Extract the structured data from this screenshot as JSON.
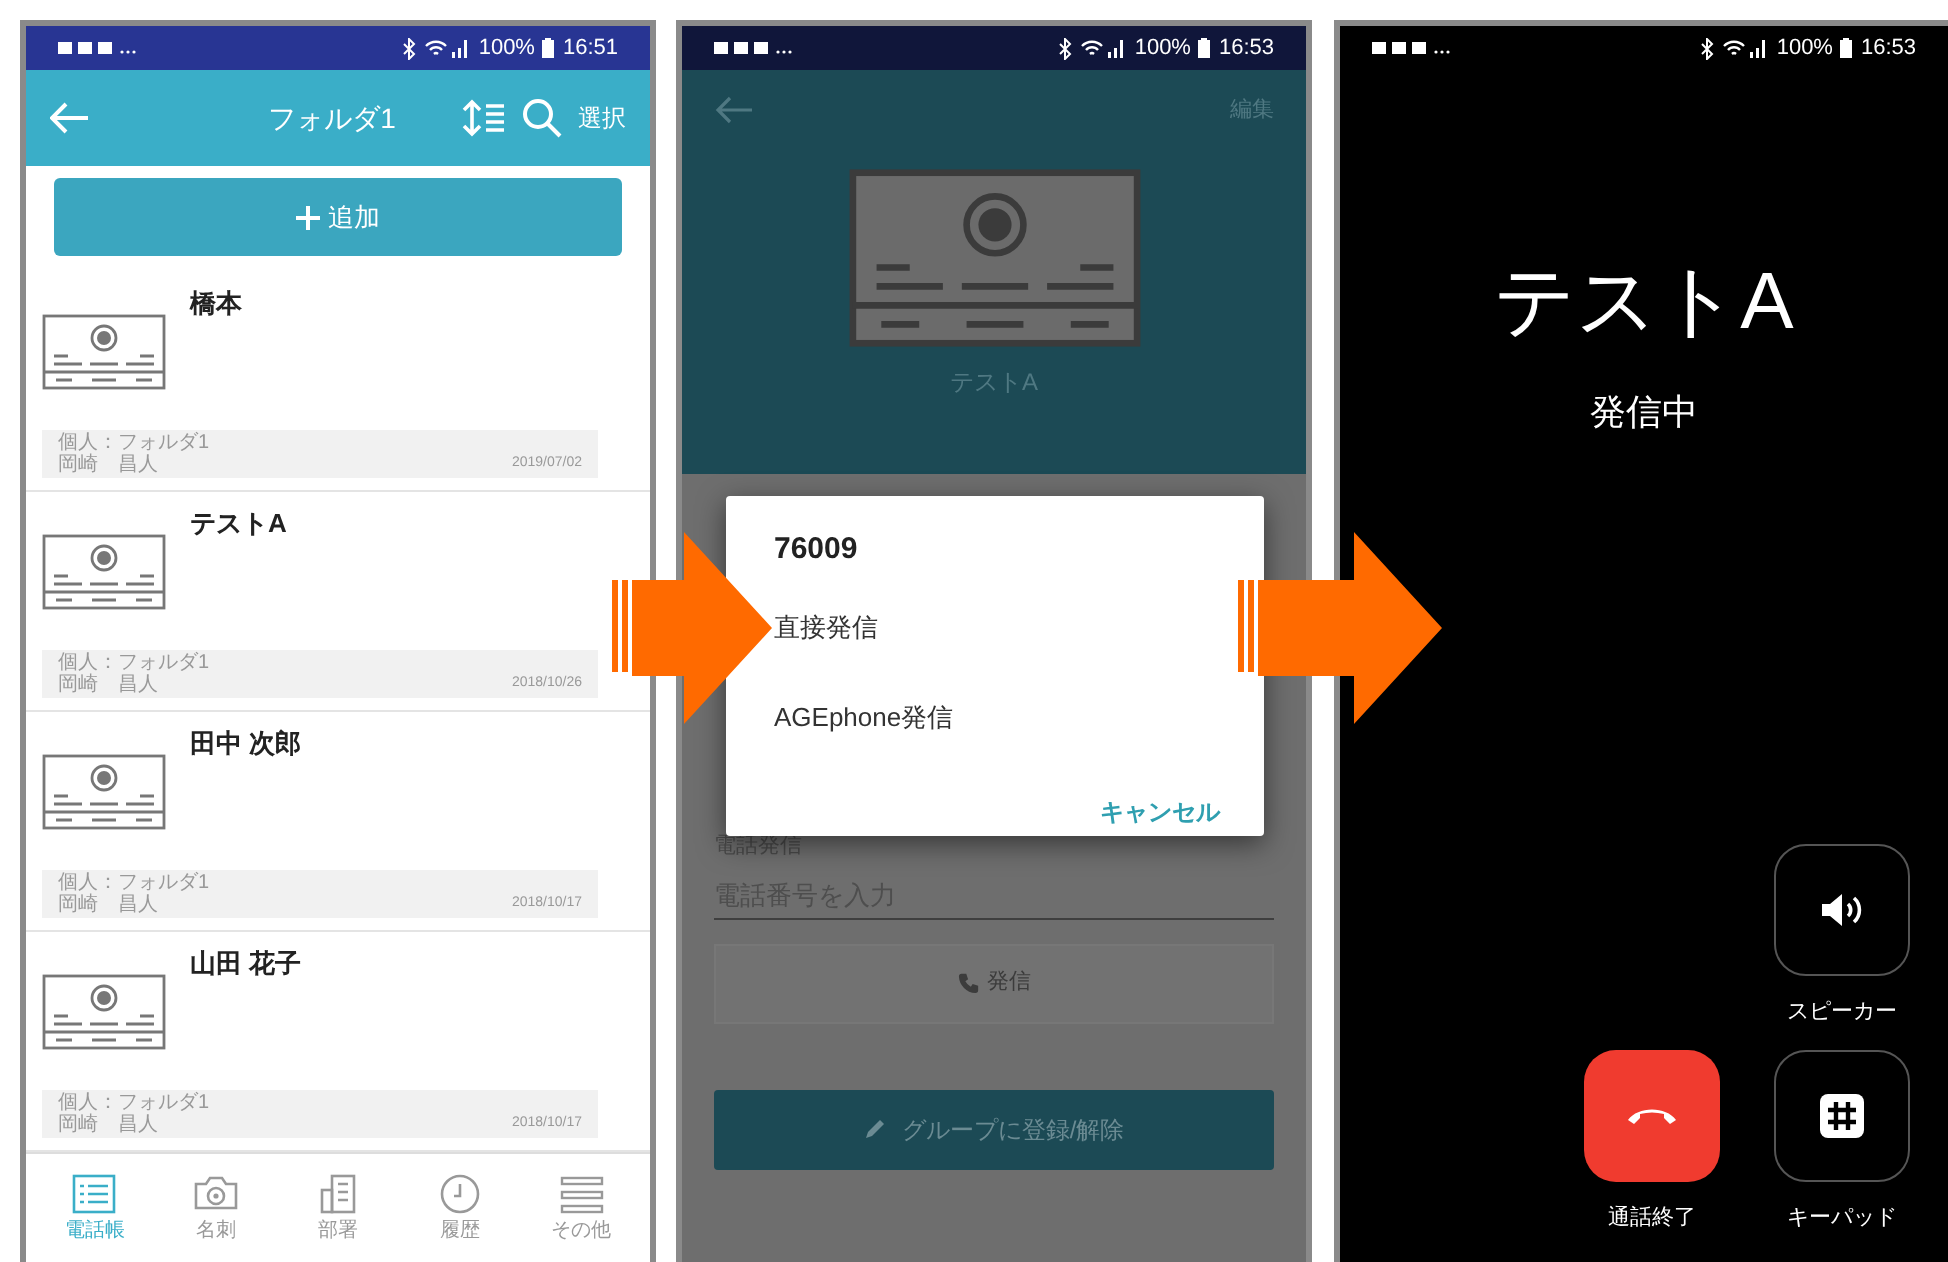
{
  "list_screen": {
    "status_bar": {
      "battery": "100%",
      "time": "16:51"
    },
    "header": {
      "title": "フォルダ1",
      "action": "選択"
    },
    "add_button": {
      "label": "追加"
    },
    "contacts": [
      {
        "name": "橋本",
        "folder": "個人：フォルダ1",
        "owner": "岡崎　昌人",
        "date": "2019/07/02"
      },
      {
        "name": "テストA",
        "folder": "個人：フォルダ1",
        "owner": "岡崎　昌人",
        "date": "2018/10/26"
      },
      {
        "name": "田中 次郎",
        "folder": "個人：フォルダ1",
        "owner": "岡崎　昌人",
        "date": "2018/10/17"
      },
      {
        "name": "山田 花子",
        "folder": "個人：フォルダ1",
        "owner": "岡崎　昌人",
        "date": "2018/10/17"
      }
    ],
    "nav": [
      {
        "kind": "list",
        "label": "電話帳",
        "selected": true
      },
      {
        "kind": "camera",
        "label": "名刺",
        "selected": false
      },
      {
        "kind": "building",
        "label": "部署",
        "selected": false
      },
      {
        "kind": "clock",
        "label": "履歴",
        "selected": false
      },
      {
        "kind": "menu",
        "label": "その他",
        "selected": false
      }
    ]
  },
  "detail_screen": {
    "status_bar": {
      "battery": "100%",
      "time": "16:53"
    },
    "header": {
      "edit": "編集",
      "name": "テストA"
    },
    "phone_label": "電話発信",
    "phone_input": {
      "placeholder": "電話番号を入力"
    },
    "call_button": {
      "label": "発信",
      "disabled": true
    },
    "group_button": {
      "label": "グループに登録/解除"
    },
    "dialog": {
      "title": "76009",
      "options": [
        "直接発信",
        "AGEphone発信"
      ],
      "cancel": "キャンセル"
    }
  },
  "call_screen": {
    "status_bar": {
      "battery": "100%",
      "time": "16:53"
    },
    "name": "テストA",
    "status": "発信中",
    "buttons": [
      {
        "kind": "speaker",
        "label": "スピーカー"
      },
      {
        "kind": "end",
        "label": "通話終了"
      },
      {
        "kind": "keypad",
        "label": "キーパッド"
      }
    ]
  }
}
